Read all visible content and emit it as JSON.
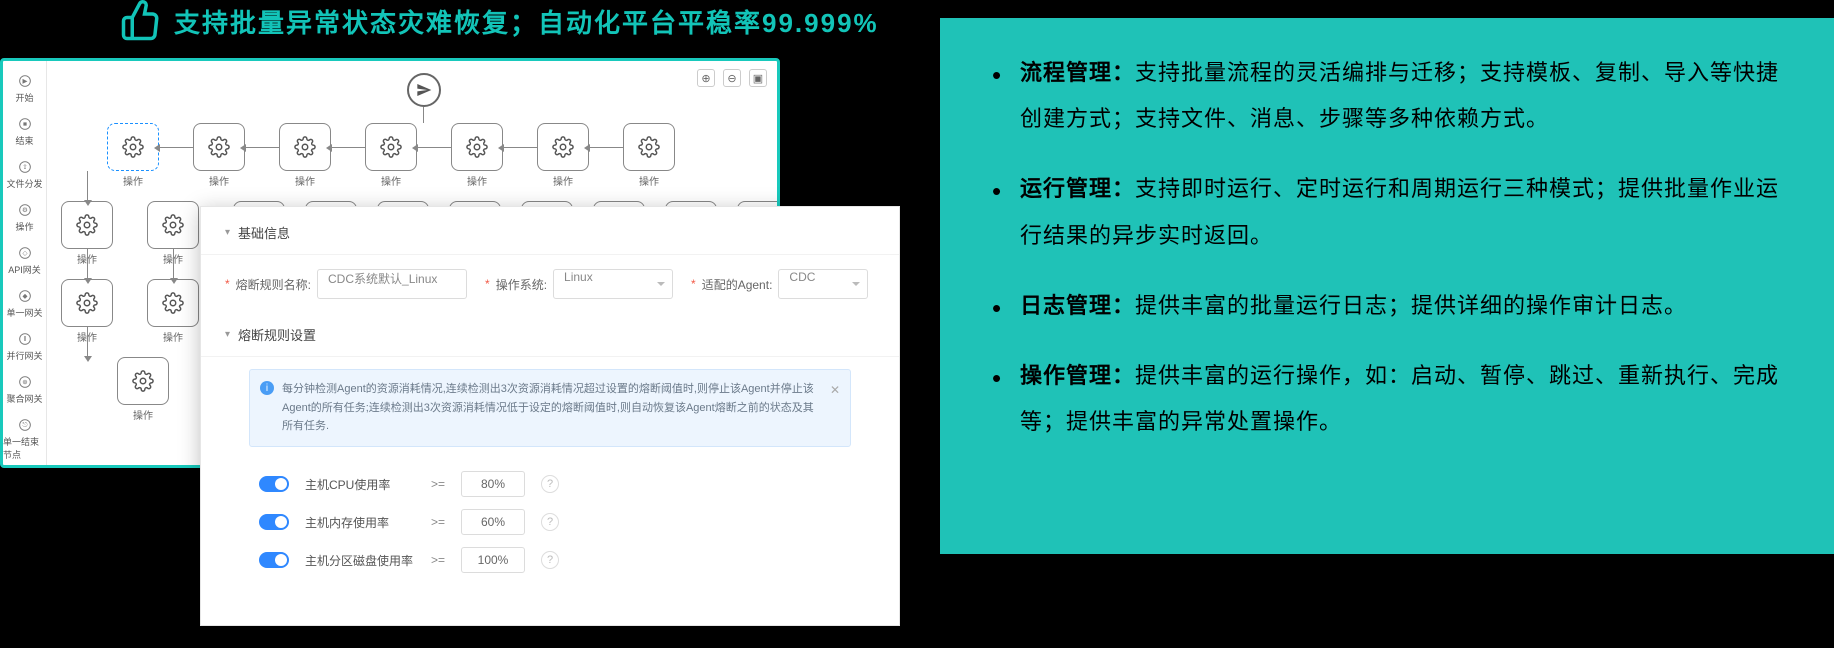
{
  "headline": "支持批量异常状态灾难恢复；自动化平台平稳率99.999%",
  "tool_rail": [
    "开始",
    "结束",
    "文件分发",
    "操作",
    "API网关",
    "单一网关",
    "并行网关",
    "聚合网关",
    "单一结束节点"
  ],
  "flow": {
    "node_label": "操作"
  },
  "form": {
    "section1_title": "基础信息",
    "section2_title": "熔断规则设置",
    "rule_name_label": "熔断规则名称:",
    "rule_name_value": "CDC系统默认_Linux",
    "os_label": "操作系统:",
    "os_value": "Linux",
    "agent_label": "适配的Agent:",
    "agent_value": "CDC",
    "alert_text": "每分钟检测Agent的资源消耗情况,连续检测出3次资源消耗情况超过设置的熔断阈值时,则停止该Agent并停止该Agent的所有任务;连续检测出3次资源消耗情况低于设定的熔断阈值时,则自动恢复该Agent熔断之前的状态及其所有任务.",
    "metrics": [
      {
        "label": "主机CPU使用率",
        "op": ">=",
        "val": "80%"
      },
      {
        "label": "主机内存使用率",
        "op": ">=",
        "val": "60%"
      },
      {
        "label": "主机分区磁盘使用率",
        "op": ">=",
        "val": "100%"
      }
    ]
  },
  "bullets": [
    {
      "title": "流程管理：",
      "body": "支持批量流程的灵活编排与迁移；支持模板、复制、导入等快捷创建方式；支持文件、消息、步骤等多种依赖方式。"
    },
    {
      "title": "运行管理：",
      "body": "支持即时运行、定时运行和周期运行三种模式；提供批量作业运行结果的异步实时返回。"
    },
    {
      "title": "日志管理：",
      "body": "提供丰富的批量运行日志；提供详细的操作审计日志。"
    },
    {
      "title": "操作管理：",
      "body": "提供丰富的运行操作，如：启动、暂停、跳过、重新执行、完成等；提供丰富的异常处置操作。"
    }
  ]
}
